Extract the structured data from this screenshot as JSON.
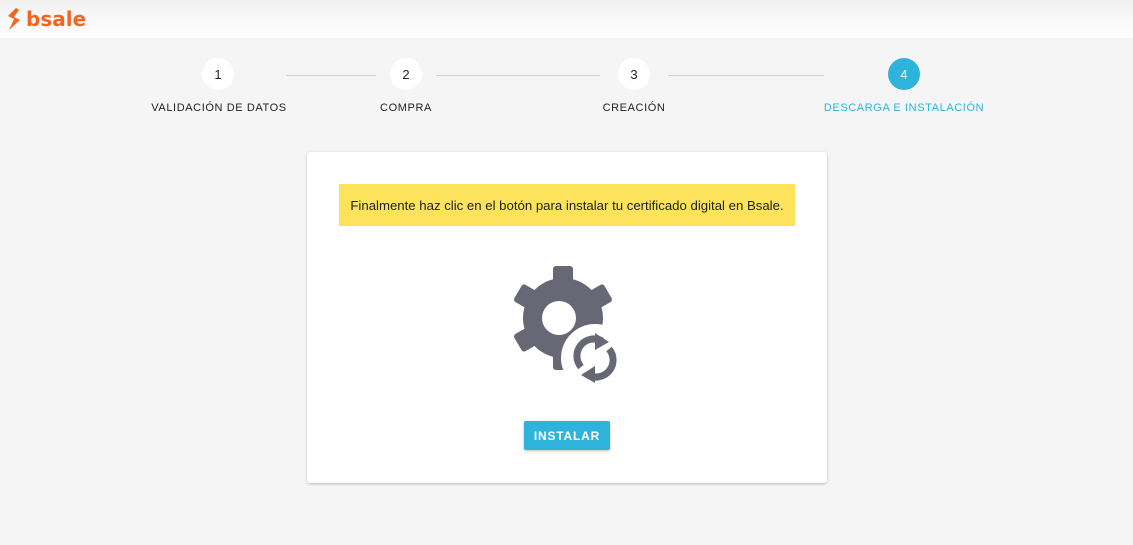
{
  "brand": {
    "name": "bsale",
    "color": "#f26522"
  },
  "stepper": {
    "active_color": "#2eb4dc",
    "steps": [
      {
        "number": "1",
        "label": "VALIDACIÓN DE DATOS",
        "active": false
      },
      {
        "number": "2",
        "label": "COMPRA",
        "active": false
      },
      {
        "number": "3",
        "label": "CREACIÓN",
        "active": false
      },
      {
        "number": "4",
        "label": "DESCARGA E INSTALACIÓN",
        "active": true
      }
    ]
  },
  "card": {
    "notice_text": "Finalmente haz clic en el botón para instalar tu certificado digital en Bsale.",
    "notice_color": "#fde25c",
    "illustration_icon": "settings-sync-icon",
    "install_button_label": "INSTALAR"
  }
}
